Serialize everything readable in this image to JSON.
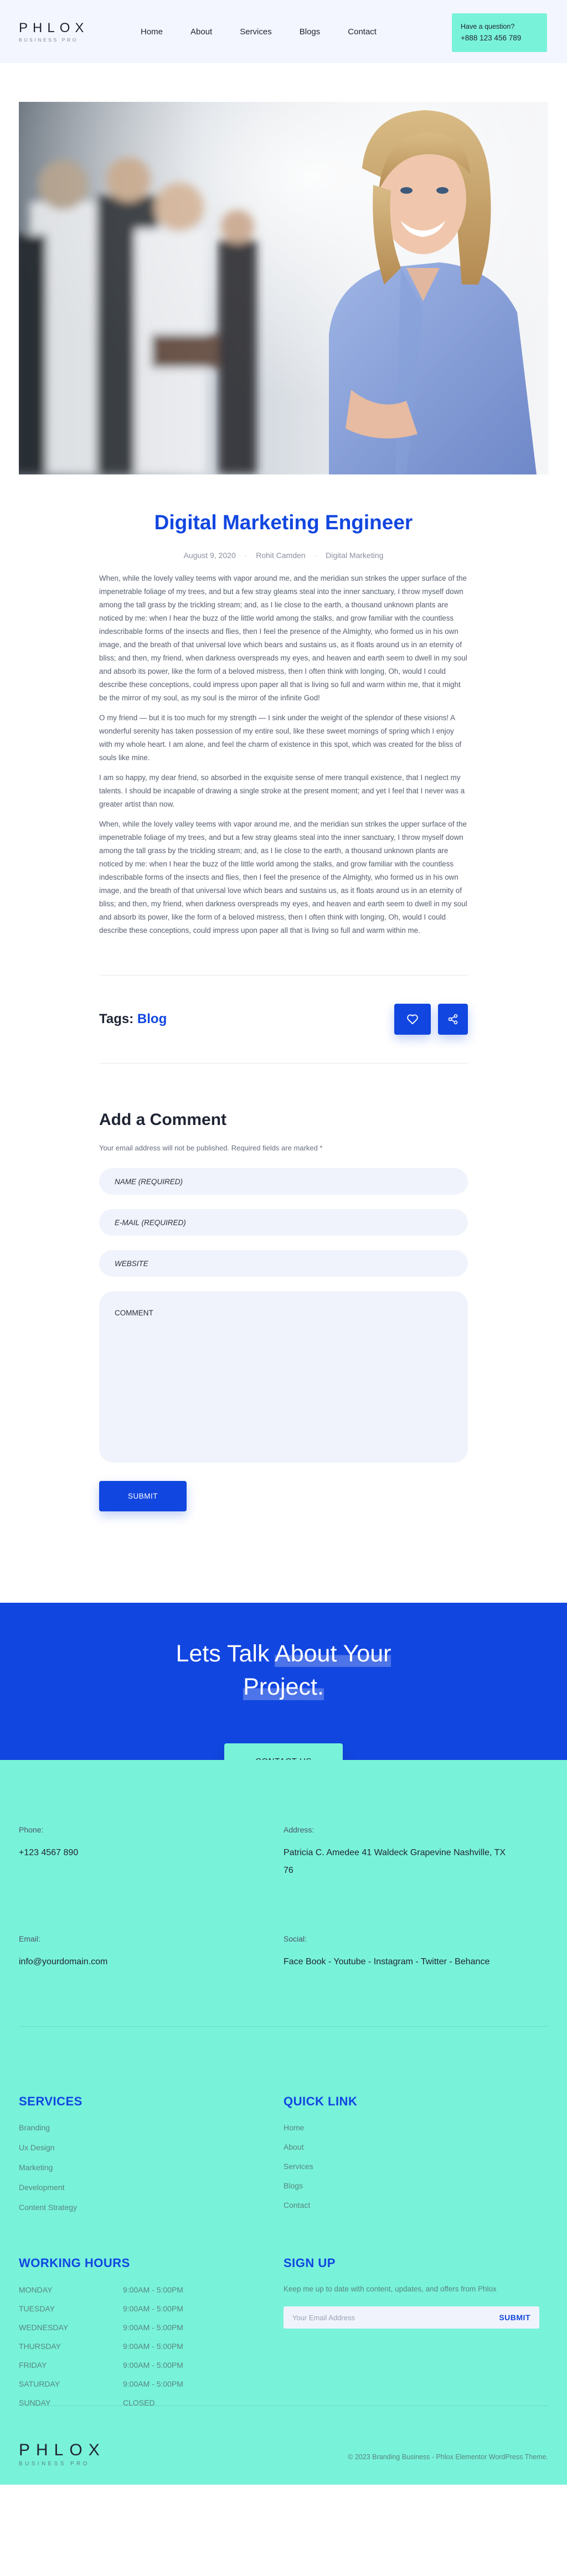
{
  "header": {
    "logo_main": "PHLOX",
    "logo_sub": "BUSINESS PRO",
    "nav": [
      "Home",
      "About",
      "Services",
      "Blogs",
      "Contact"
    ],
    "call_question": "Have a question?",
    "call_number": "+888 123 456 789"
  },
  "post": {
    "title": "Digital Marketing Engineer",
    "date": "August 9, 2020",
    "author": "Rohit Camden",
    "category": "Digital Marketing",
    "paragraphs": [
      "When, while the lovely valley teems with vapor around me, and the meridian sun strikes the upper surface of the impenetrable foliage of my trees, and but a few stray gleams steal into the inner sanctuary, I throw myself down among the tall grass by the trickling stream; and, as I lie close to the earth, a thousand unknown plants are noticed by me: when I hear the buzz of the little world among the stalks, and grow familiar with the countless indescribable forms of the insects and flies, then I feel the presence of the Almighty, who formed us in his own image, and the breath of that universal love which bears and sustains us, as it floats around us in an eternity of bliss; and then, my friend, when darkness overspreads my eyes, and heaven and earth seem to dwell in my soul and absorb its power, like the form of a beloved mistress, then I often think with longing, Oh, would I could describe these conceptions, could impress upon paper all that is living so full and warm within me, that it might be the mirror of my soul, as my soul is the mirror of the infinite God!",
      "O my friend — but it is too much for my strength — I sink under the weight of the splendor of these visions! A wonderful serenity has taken possession of my entire soul, like these sweet mornings of spring which I enjoy with my whole heart. I am alone, and feel the charm of existence in this spot, which was created for the bliss of souls like mine.",
      "I am so happy, my dear friend, so absorbed in the exquisite sense of mere tranquil existence, that I neglect my talents. I should be incapable of drawing a single stroke at the present moment; and yet I feel that I never was a greater artist than now.",
      "When, while the lovely valley teems with vapor around me, and the meridian sun strikes the upper surface of the impenetrable foliage of my trees, and but a few stray gleams steal into the inner sanctuary, I throw myself down among the tall grass by the trickling stream; and, as I lie close to the earth, a thousand unknown plants are noticed by me: when I hear the buzz of the little world among the stalks, and grow familiar with the countless indescribable forms of the insects and flies, then I feel the presence of the Almighty, who formed us in his own image, and the breath of that universal love which bears and sustains us, as it floats around us in an eternity of bliss; and then, my friend, when darkness overspreads my eyes, and heaven and earth seem to dwell in my soul and absorb its power, like the form of a beloved mistress, then I often think with longing, Oh, would I could describe these conceptions, could impress upon paper all that is living so full and warm within me."
    ],
    "tags_label": "Tags:",
    "tag": "Blog",
    "like_icon": "heart-icon",
    "share_icon": "share-icon"
  },
  "comment": {
    "title": "Add a Comment",
    "note": "Your email address will not be published. Required fields are marked *",
    "name_placeholder": "NAME (REQUIRED)",
    "email_placeholder": "E-MAIL (REQUIRED)",
    "website_placeholder": "WEBSITE",
    "comment_placeholder": "COMMENT",
    "submit": "SUBMIT"
  },
  "cta": {
    "title_line1_plain": "Lets Talk ",
    "title_line1_hl": "About Your",
    "title_line2_hl": "Project.",
    "button": "CONTACT US"
  },
  "footer": {
    "phone_label": "Phone:",
    "phone": "+123 4567 890",
    "address_label": "Address:",
    "address": "Patricia C. Amedee 41 Waldeck Grapevine Nashville, TX 76",
    "email_label": "Email:",
    "email": "info@yourdomain.com",
    "social_label": "Social:",
    "social": "Face Book  -  Youtube  -  Instagram  -  Twitter  -  Behance",
    "services_title": "SERVICES",
    "services": [
      "Branding",
      "Ux Design",
      "Marketing",
      "Development",
      "Content Strategy"
    ],
    "quicklink_title": "QUICK LINK",
    "quicklinks": [
      "Home",
      "About",
      "Services",
      "Blogs",
      "Contact"
    ],
    "hours_title": "WORKING HOURS",
    "hours": [
      {
        "day": "MONDAY",
        "time": "9:00AM - 5:00PM"
      },
      {
        "day": "TUESDAY",
        "time": "9:00AM - 5:00PM"
      },
      {
        "day": "WEDNESDAY",
        "time": "9:00AM - 5:00PM"
      },
      {
        "day": "THURSDAY",
        "time": "9:00AM - 5:00PM"
      },
      {
        "day": "FRIDAY",
        "time": "9:00AM - 5:00PM"
      },
      {
        "day": "SATURDAY",
        "time": "9:00AM - 5:00PM"
      },
      {
        "day": "SUNDAY",
        "time": "CLOSED"
      }
    ],
    "signup_title": "SIGN UP",
    "signup_note": "Keep me up to date with content, updates, and offers from Phlox",
    "signup_placeholder": "Your Email Address",
    "signup_button": "SUBMIT",
    "logo_main": "PHLOX",
    "logo_sub": "BUSINESS PRO",
    "copyright": "© 2023 Branding Business - Phlox Elementor WordPress Theme."
  },
  "colors": {
    "brand_blue": "#1146e0",
    "mint": "#79f2da",
    "header_bg": "#f3f6ff"
  }
}
